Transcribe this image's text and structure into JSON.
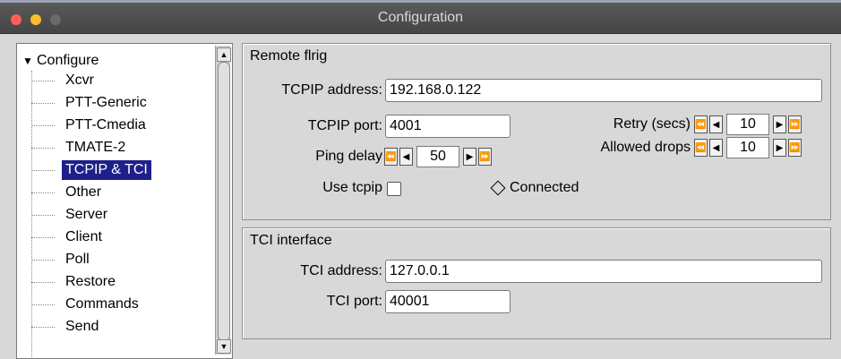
{
  "window": {
    "title": "Configuration"
  },
  "tree": {
    "root": "Configure",
    "items": [
      "Xcvr",
      "PTT-Generic",
      "PTT-Cmedia",
      "TMATE-2",
      "TCPIP & TCI",
      "Other",
      "Server",
      "Client",
      "Poll",
      "Restore",
      "Commands",
      "Send"
    ],
    "selected": "TCPIP & TCI"
  },
  "remote": {
    "title": "Remote flrig",
    "address_label": "TCPIP address:",
    "address_value": "192.168.0.122",
    "port_label": "TCPIP port:",
    "port_value": "4001",
    "retry_label": "Retry (secs)",
    "retry_value": "10",
    "ping_label": "Ping delay",
    "ping_value": "50",
    "drops_label": "Allowed drops",
    "drops_value": "10",
    "use_tcpip_label": "Use tcpip",
    "connected_label": "Connected"
  },
  "tci": {
    "title": "TCI interface",
    "address_label": "TCI address:",
    "address_value": "127.0.0.1",
    "port_label": "TCI port:",
    "port_value": "40001"
  },
  "icons": {
    "fast_back": "⏪",
    "back": "◀",
    "fwd": "▶",
    "fast_fwd": "⏩"
  }
}
